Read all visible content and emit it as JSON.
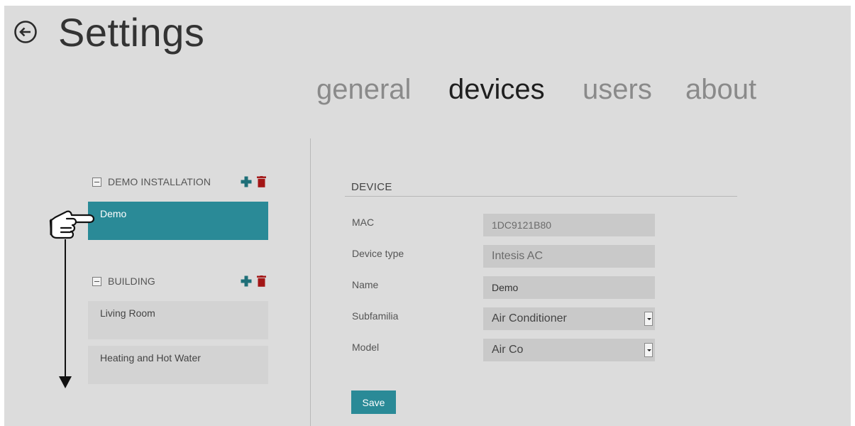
{
  "header": {
    "title": "Settings",
    "back_icon": "circle-arrow-left-icon"
  },
  "tabs": [
    {
      "label": "general",
      "active": false
    },
    {
      "label": "devices",
      "active": true
    },
    {
      "label": "users",
      "active": false
    },
    {
      "label": "about",
      "active": false
    }
  ],
  "sidebar": {
    "groups": [
      {
        "label": "DEMO INSTALLATION",
        "devices": [
          "Demo"
        ]
      },
      {
        "label": "BUILDING",
        "devices": [
          "Living Room",
          "Heating and Hot Water"
        ]
      }
    ],
    "selected_device": "Demo",
    "icons": {
      "add": "plus-icon",
      "delete": "trash-icon",
      "collapse": "collapse-box-icon"
    }
  },
  "annotation": {
    "pointer_icon": "pointing-hand-icon",
    "arrow_icon": "down-arrow-icon"
  },
  "form": {
    "section_title": "DEVICE",
    "fields": {
      "mac": {
        "label": "MAC",
        "value": "1DC9121B80"
      },
      "device_type": {
        "label": "Device type",
        "value": "Intesis AC"
      },
      "name": {
        "label": "Name",
        "value": "Demo"
      },
      "subfamilia": {
        "label": "Subfamilia",
        "value": "Air Conditioner"
      },
      "model": {
        "label": "Model",
        "value": "Air Co"
      }
    },
    "save_label": "Save"
  },
  "colors": {
    "panel_bg": "#dcdcdc",
    "accent": "#2a8a97",
    "add_icon": "#1f6f78",
    "delete_icon": "#a31616",
    "active_tab": "#1f1f1f",
    "inactive_tab": "#8a8a8a"
  }
}
